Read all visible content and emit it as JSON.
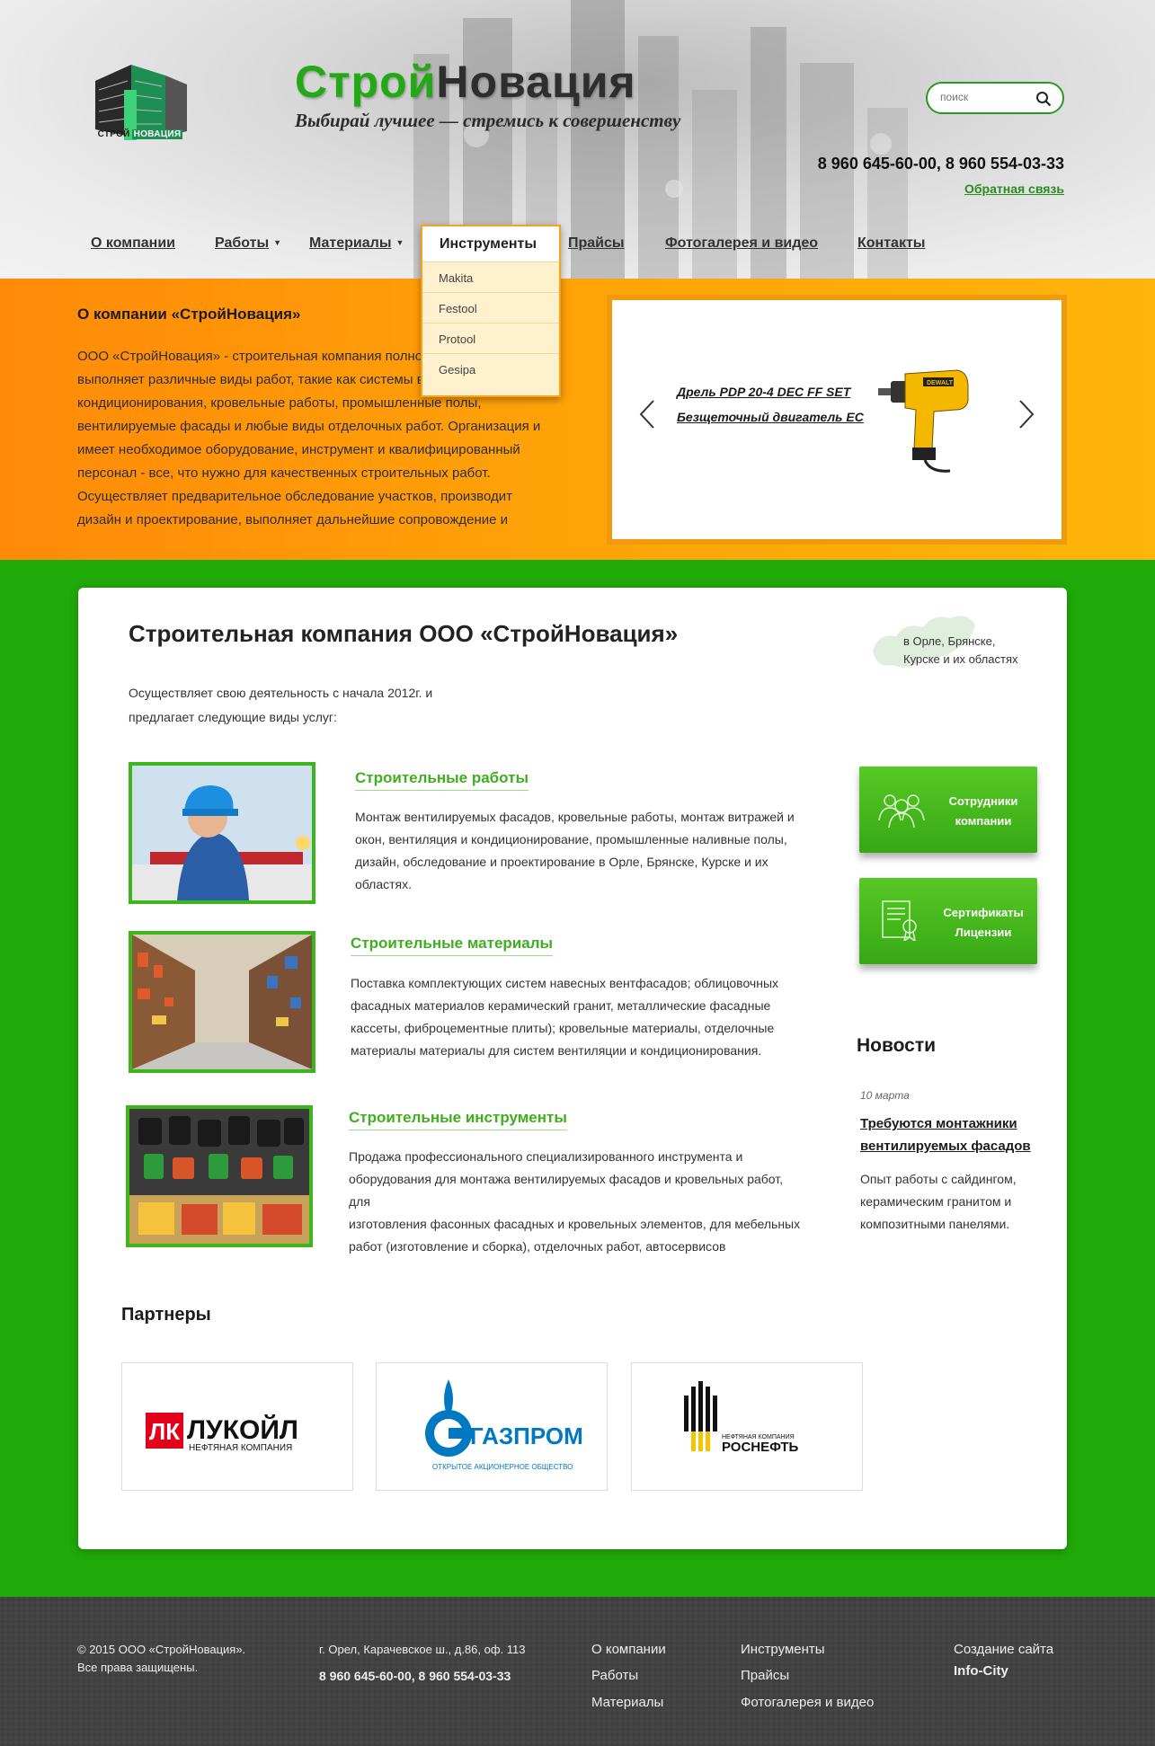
{
  "header": {
    "brand_part1": "Строй",
    "brand_part2": "Новация",
    "logo_caption_1": "СТРОЙ",
    "logo_caption_2": "НОВАЦИЯ",
    "slogan": "Выбирай лучшее — стремись к совершенству",
    "search_placeholder": "поиск",
    "phones": "8 960 645-60-00, 8 960 554-03-33",
    "feedback": "Обратная связь"
  },
  "nav": {
    "items": [
      {
        "label": "О компании"
      },
      {
        "label": "Работы"
      },
      {
        "label": "Материалы"
      },
      {
        "label": "Инструменты"
      },
      {
        "label": "Прайсы"
      },
      {
        "label": "Фотогалерея и видео"
      },
      {
        "label": "Контакты"
      }
    ]
  },
  "dropdown": {
    "title": "Инструменты",
    "items": [
      "Makita",
      "Festool",
      "Protool",
      "Gesipa"
    ]
  },
  "about": {
    "title": "О компании «СтройНовация»",
    "lines": [
      "ООО «СтройНовация» - строительная компания полно",
      "выполняет различные виды работ, такие как системы в",
      "кондиционирования, кровельные работы, промышленные полы,",
      "вентилируемые фасады и любые виды отделочных работ. Организация и",
      "имеет необходимое оборудование, инструмент и квалифицированный",
      "персонал - все, что нужно для качественных строительных работ.",
      "Осуществляет предварительное обследование участков, производит",
      "дизайн и проектирование, выполняет дальнейшие сопровождение и"
    ]
  },
  "slider": {
    "line1": "Дрель PDP 20-4 DEC FF SET",
    "line2": "Безщеточный двигатель EC"
  },
  "main": {
    "title": "Строительная компания ООО «СтройНовация»",
    "intro_1": "Осуществляет свою деятельность с начала 2012г. и",
    "intro_2": "предлагает следующие виды услуг:",
    "region_1": "в Орле, Брянске,",
    "region_2": "Курске и их областях",
    "services": [
      {
        "title": "Строительные работы",
        "lines": [
          "Монтаж вентилируемых фасадов, кровельные работы, монтаж витражей и",
          "окон, вентиляция и кондиционирование, промышленные наливные полы,",
          "дизайн, обследование и проектирование в Орле, Брянске, Курске и их",
          "областях."
        ]
      },
      {
        "title": "Строительные материалы",
        "lines": [
          "Поставка комплектующих систем навесных вентфасадов; облицовочных",
          "фасадных материалов керамический гранит, металлические фасадные",
          "кассеты, фиброцементные плиты); кровельные материалы, отделочные",
          "материалы материалы для систем вентиляции и кондиционирования."
        ]
      },
      {
        "title": "Строительные инструменты",
        "lines": [
          "Продажа профессионального специализированного инструмента и",
          "оборудования для монтажа вентилируемых фасадов и кровельных работ, для",
          "изготовления фасонных фасадных и кровельных элементов, для мебельных",
          "работ (изготовление и сборка), отделочных работ, автосервисов"
        ]
      }
    ],
    "side_buttons": [
      {
        "line1": "Сотрудники",
        "line2": "компании",
        "icon": "people-icon"
      },
      {
        "line1": "Сертификаты",
        "line2": "Лицензии",
        "icon": "certificate-icon"
      }
    ],
    "news": {
      "heading": "Новости",
      "date": "10 марта",
      "title_1": "Требуются монтажники",
      "title_2": "вентилируемых фасадов",
      "text_1": "Опыт работы с сайдингом,",
      "text_2": "керамическим гранитом и",
      "text_3": "композитными панелями."
    },
    "partners_heading": "Партнеры",
    "partners": [
      {
        "name": "ЛУКОЙЛ",
        "sub": "НЕФТЯНАЯ КОМПАНИЯ"
      },
      {
        "name": "ГАЗПРОМ",
        "sub": "ОТКРЫТОЕ АКЦИОНЕРНОЕ ОБЩЕСТВО"
      },
      {
        "name": "РОСНЕФТЬ",
        "sub": "НЕФТЯНАЯ КОМПАНИЯ"
      }
    ]
  },
  "footer": {
    "copyright_1": "© 2015 ООО «СтройНовация».",
    "copyright_2": "Все права защищены.",
    "address": "г. Орел, Карачевское ш., д.86, оф. 113",
    "phones": "8 960 645-60-00, 8 960 554-03-33",
    "links_col1": [
      "О компании",
      "Работы",
      "Материалы"
    ],
    "links_col2": [
      "Инструменты",
      "Прайсы",
      "Фотогалерея и видео"
    ],
    "dev_1": "Создание сайта",
    "dev_2": "Info-City"
  },
  "colors": {
    "accent_green": "#23a816",
    "orange": "#ffa108",
    "page_green": "#1faa09"
  }
}
